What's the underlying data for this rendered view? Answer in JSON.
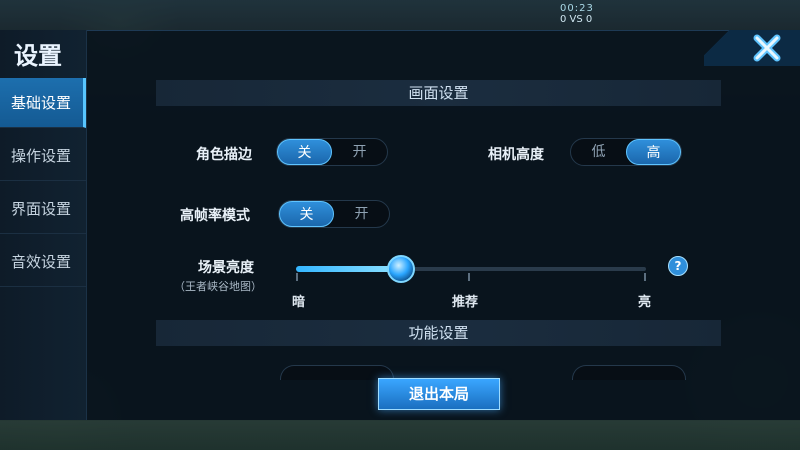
{
  "status": {
    "time": "00:23",
    "score": "0 VS 0"
  },
  "sidebar": {
    "title": "设置",
    "items": [
      {
        "label": "基础设置",
        "active": true
      },
      {
        "label": "操作设置",
        "active": false
      },
      {
        "label": "界面设置",
        "active": false
      },
      {
        "label": "音效设置",
        "active": false
      }
    ]
  },
  "sections": {
    "graphics": "画面设置",
    "function": "功能设置"
  },
  "settings": {
    "outline": {
      "label": "角色描边",
      "off": "关",
      "on": "开",
      "selected": "关"
    },
    "camera": {
      "label": "相机高度",
      "low": "低",
      "high": "高",
      "selected": "高"
    },
    "high_fps": {
      "label": "高帧率模式",
      "off": "关",
      "on": "开",
      "selected": "关"
    },
    "brightness": {
      "label": "场景亮度",
      "sublabel": "（王者峡谷地图）",
      "min_label": "暗",
      "mid_label": "推荐",
      "max_label": "亮",
      "value": 0.3
    }
  },
  "buttons": {
    "exit": "退出本局",
    "help": "?"
  },
  "colors": {
    "accent": "#2f8fdb",
    "active_nav": "#1d6fae"
  }
}
